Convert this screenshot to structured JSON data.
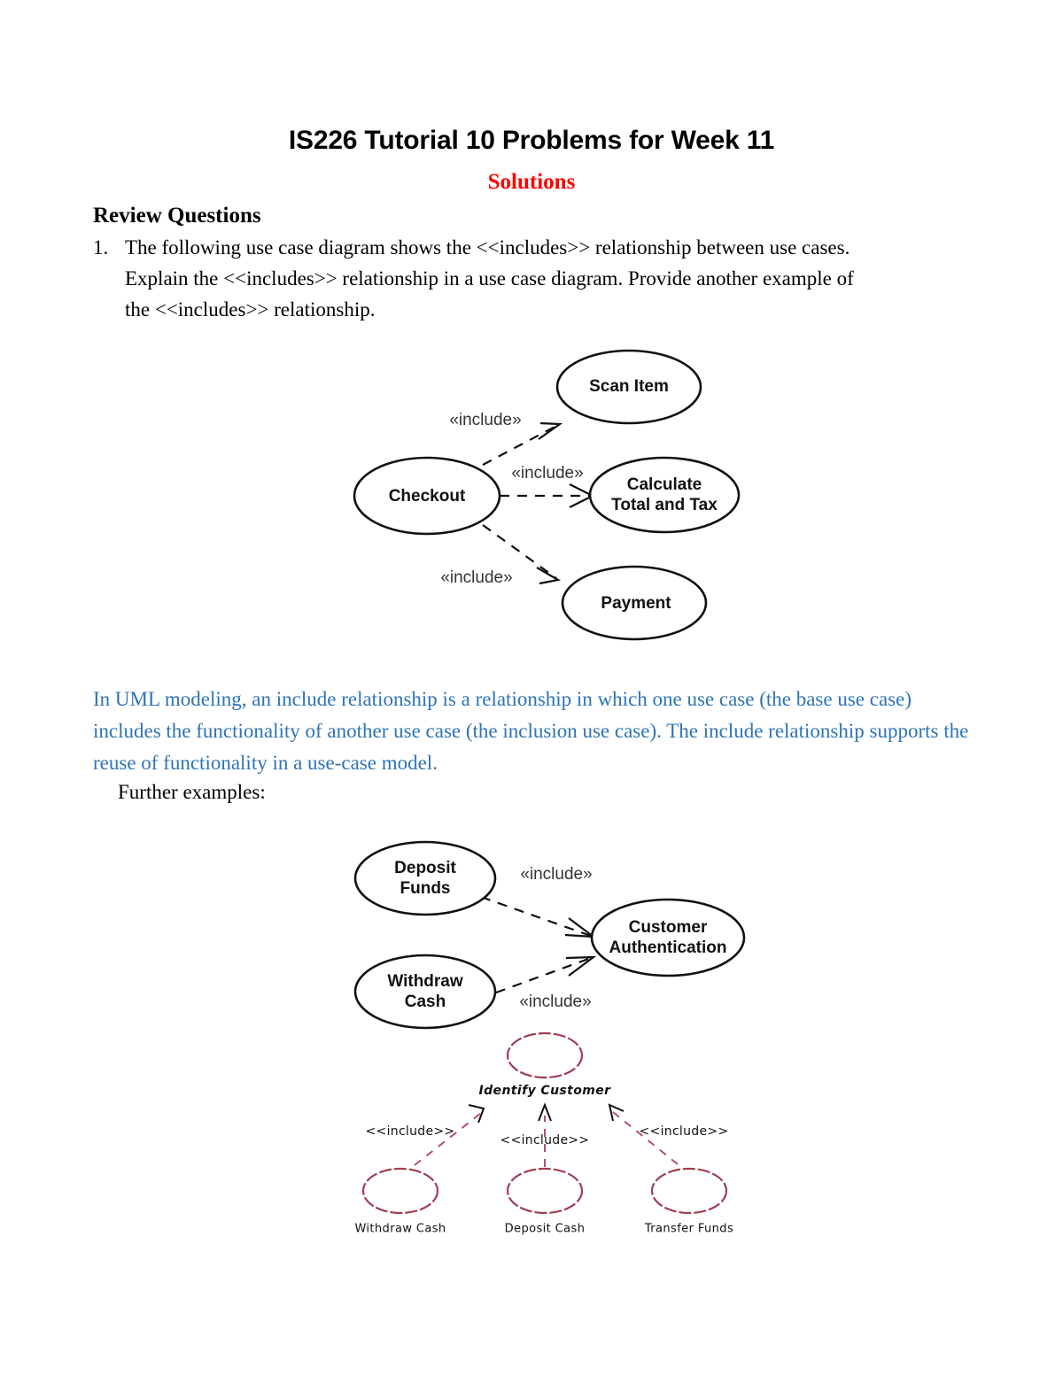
{
  "document": {
    "title": "IS226 Tutorial 10 Problems for Week 11",
    "subtitle": "Solutions",
    "section_heading": "Review Questions"
  },
  "question": {
    "number": "1.",
    "line1": "The following use case diagram shows the <<includes>> relationship between use cases.",
    "line2": "Explain the <<includes>> relationship in a use case diagram. Provide another example of",
    "line3": "the <<includes>> relationship.",
    "full_text": "The following use case diagram shows the <<includes>> relationship between use cases. Explain the <<includes>> relationship in a use case diagram. Provide another example of the <<includes>> relationship."
  },
  "answer": {
    "paragraph": "In UML modeling, an include relationship is a relationship in which one use case (the base use case) includes the functionality of another use case (the inclusion use case). The include relationship supports the reuse of functionality in a use-case model.",
    "further_examples_label": "Further examples:",
    "color": "#2e74b5"
  },
  "diagrams": {
    "checkout": {
      "name": "checkout-use-case-diagram",
      "use_cases": [
        {
          "id": "checkout",
          "label": "Checkout"
        },
        {
          "id": "scan-item",
          "label": "Scan Item"
        },
        {
          "id": "calculate-total-and-tax",
          "label_line1": "Calculate",
          "label_line2": "Total and Tax"
        },
        {
          "id": "payment",
          "label": "Payment"
        }
      ],
      "relationships": [
        {
          "from": "checkout",
          "to": "scan-item",
          "stereotype": "«include»"
        },
        {
          "from": "checkout",
          "to": "calculate-total-and-tax",
          "stereotype": "«include»"
        },
        {
          "from": "checkout",
          "to": "payment",
          "stereotype": "«include»"
        }
      ]
    },
    "atm": {
      "name": "atm-use-case-diagram",
      "use_cases": [
        {
          "id": "deposit-funds",
          "label_line1": "Deposit",
          "label_line2": "Funds"
        },
        {
          "id": "withdraw-cash",
          "label_line1": "Withdraw",
          "label_line2": "Cash"
        },
        {
          "id": "customer-authentication",
          "label_line1": "Customer",
          "label_line2": "Authentication"
        }
      ],
      "relationships": [
        {
          "from": "deposit-funds",
          "to": "customer-authentication",
          "stereotype": "«include»"
        },
        {
          "from": "withdraw-cash",
          "to": "customer-authentication",
          "stereotype": "«include»"
        }
      ]
    },
    "identify_customer": {
      "name": "identify-customer-use-case-diagram",
      "stroke_color": "#9e3f52",
      "use_cases": [
        {
          "id": "identify-customer",
          "label": "Identify Customer"
        },
        {
          "id": "withdraw-cash",
          "label": "Withdraw Cash"
        },
        {
          "id": "deposit-cash",
          "label": "Deposit Cash"
        },
        {
          "id": "transfer-funds",
          "label": "Transfer Funds"
        }
      ],
      "relationships": [
        {
          "from": "withdraw-cash",
          "to": "identify-customer",
          "stereotype": "<<include>>"
        },
        {
          "from": "deposit-cash",
          "to": "identify-customer",
          "stereotype": "<<include>>"
        },
        {
          "from": "transfer-funds",
          "to": "identify-customer",
          "stereotype": "<<include>>"
        }
      ]
    }
  }
}
